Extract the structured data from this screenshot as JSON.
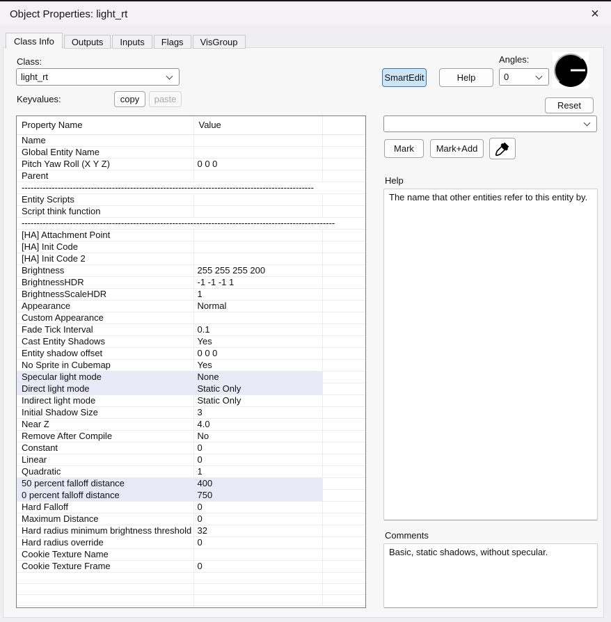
{
  "window": {
    "title": "Object Properties: light_rt",
    "close_glyph": "×"
  },
  "tabs": [
    {
      "label": "Class Info",
      "active": true
    },
    {
      "label": "Outputs",
      "active": false
    },
    {
      "label": "Inputs",
      "active": false
    },
    {
      "label": "Flags",
      "active": false
    },
    {
      "label": "VisGroup",
      "active": false
    }
  ],
  "class_section": {
    "label": "Class:",
    "value": "light_rt",
    "keyvalues_label": "Keyvalues:",
    "copy_label": "copy",
    "paste_label": "paste"
  },
  "toolbar": {
    "smartedit_label": "SmartEdit",
    "help_label": "Help",
    "angles_label": "Angles:",
    "angles_value": "0",
    "reset_label": "Reset"
  },
  "mark_section": {
    "combo_value": "",
    "mark_label": "Mark",
    "mark_add_label": "Mark+Add",
    "eyedropper_icon": "eyedropper-icon"
  },
  "help_section": {
    "label": "Help",
    "text": "The name that other entities refer to this entity by."
  },
  "comments_section": {
    "label": "Comments",
    "text": "Basic, static shadows, without specular."
  },
  "properties_table": {
    "columns": [
      "Property Name",
      "Value"
    ],
    "rows": [
      {
        "name": "Name",
        "value": ""
      },
      {
        "name": "Global Entity Name",
        "value": ""
      },
      {
        "name": "Pitch Yaw Roll (X Y Z)",
        "value": "0 0 0"
      },
      {
        "name": "Parent",
        "value": ""
      },
      {
        "separator": true,
        "dashes": "-------------------------------------------------------------------------------------------------"
      },
      {
        "name": "Entity Scripts",
        "value": ""
      },
      {
        "name": "Script think function",
        "value": ""
      },
      {
        "separator": true,
        "dashes": "--------------------------------------------------------------------------------------------------------"
      },
      {
        "name": "[HA] Attachment Point",
        "value": ""
      },
      {
        "name": "[HA] Init Code",
        "value": ""
      },
      {
        "name": "[HA] Init Code 2",
        "value": ""
      },
      {
        "name": "Brightness",
        "value": "255 255 255 200"
      },
      {
        "name": "BrightnessHDR",
        "value": "-1 -1 -1 1"
      },
      {
        "name": "BrightnessScaleHDR",
        "value": "1"
      },
      {
        "name": "Appearance",
        "value": "Normal"
      },
      {
        "name": "Custom Appearance",
        "value": ""
      },
      {
        "name": "Fade Tick Interval",
        "value": "0.1"
      },
      {
        "name": "Cast Entity Shadows",
        "value": "Yes"
      },
      {
        "name": "Entity shadow offset",
        "value": "0 0 0"
      },
      {
        "name": "No Sprite in Cubemap",
        "value": "Yes"
      },
      {
        "name": "Specular light mode",
        "value": "None",
        "highlight": true
      },
      {
        "name": "Direct light mode",
        "value": "Static Only",
        "highlight": true
      },
      {
        "name": "Indirect light mode",
        "value": "Static Only"
      },
      {
        "name": "Initial Shadow Size",
        "value": "3"
      },
      {
        "name": "Near Z",
        "value": "4.0"
      },
      {
        "name": "Remove After Compile",
        "value": "No"
      },
      {
        "name": "Constant",
        "value": "0"
      },
      {
        "name": "Linear",
        "value": "0"
      },
      {
        "name": "Quadratic",
        "value": "1"
      },
      {
        "name": "50 percent falloff distance",
        "value": "400",
        "highlight": true
      },
      {
        "name": "0 percent falloff distance",
        "value": "750",
        "highlight": true
      },
      {
        "name": "Hard Falloff",
        "value": "0"
      },
      {
        "name": "Maximum Distance",
        "value": "0"
      },
      {
        "name": "Hard radius minimum brightness threshold",
        "value": "32"
      },
      {
        "name": "Hard radius override",
        "value": "0"
      },
      {
        "name": "Cookie Texture Name",
        "value": ""
      },
      {
        "name": "Cookie Texture Frame",
        "value": "0"
      },
      {
        "name": "",
        "value": ""
      },
      {
        "name": "",
        "value": ""
      },
      {
        "name": "",
        "value": ""
      }
    ]
  },
  "colors": {
    "titlebar_bg": "#f5f1f6",
    "dialog_bg": "#efeff1",
    "page_bg": "#f8f7f8",
    "row_highlight": "#e9e9f8",
    "smartedit_bg": "#cde4f7",
    "smartedit_border": "#3178b5",
    "angle_indicator": "#000000"
  }
}
